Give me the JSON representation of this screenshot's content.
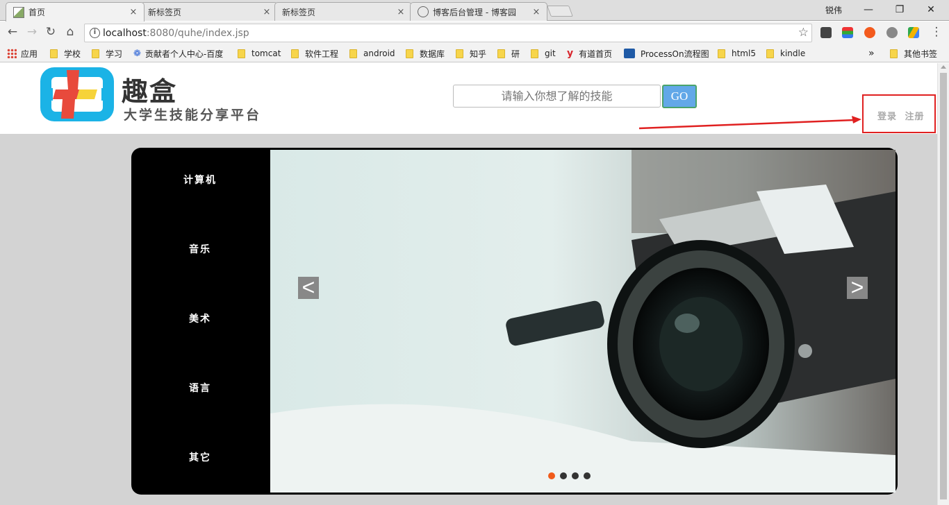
{
  "browser": {
    "tabs": [
      {
        "title": "首页",
        "active": true
      },
      {
        "title": "新标签页",
        "active": false
      },
      {
        "title": "新标签页",
        "active": false
      },
      {
        "title": "博客后台管理 - 博客园",
        "active": false
      }
    ],
    "tab_close_glyph": "×",
    "user_name": "锐伟",
    "url_host": "localhost",
    "url_rest": ":8080/quhe/index.jsp",
    "bookmarks": [
      "应用",
      "学校",
      "学习",
      "贡献者个人中心-百度",
      "tomcat",
      "软件工程",
      "android",
      "数据库",
      "知乎",
      "研",
      "git",
      "有道首页",
      "ProcessOn流程图",
      "html5",
      "kindle"
    ],
    "bookmarks_overflow": "»",
    "other_bookmarks": "其他书签"
  },
  "header": {
    "logo_title": "趣盒",
    "logo_subtitle": "大学生技能分享平台",
    "search_placeholder": "请输入你想了解的技能",
    "search_button": "GO",
    "login": "登录",
    "register": "注册"
  },
  "menu": [
    "计算机",
    "音乐",
    "美术",
    "语言",
    "其它"
  ],
  "carousel": {
    "prev": "<",
    "next": ">",
    "slide_count": 4,
    "active_index": 0
  },
  "colors": {
    "accent_blue": "#62a8e8",
    "logo_cyan": "#1bb3e6",
    "logo_red": "#e84a3c",
    "logo_yellow": "#f6d33a",
    "highlight_red": "#e02020",
    "active_dot": "#f05a1a"
  }
}
